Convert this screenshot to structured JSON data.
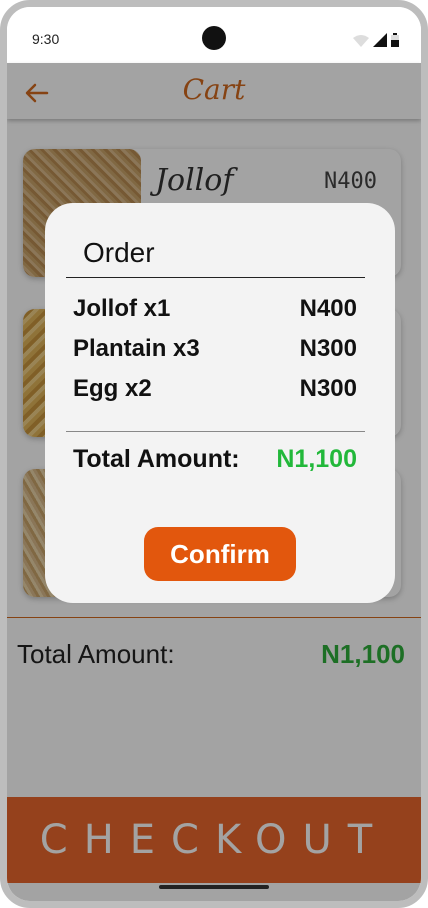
{
  "status_bar": {
    "time": "9:30"
  },
  "app_bar": {
    "title": "Cart"
  },
  "cart_items": [
    {
      "name": "Jollof",
      "price": "N400"
    }
  ],
  "summary": {
    "total_label": "Total Amount:",
    "total_value": "N1,100"
  },
  "checkout": {
    "label": "CHECKOUT"
  },
  "dialog": {
    "title": "Order",
    "items": [
      {
        "label": "Jollof x1",
        "price": "N400"
      },
      {
        "label": "Plantain x3",
        "price": "N300"
      },
      {
        "label": "Egg x2",
        "price": "N300"
      }
    ],
    "total_label": "Total Amount:",
    "total_value": "N1,100",
    "confirm_label": "Confirm"
  },
  "colors": {
    "accent": "#e9672d",
    "confirm": "#e2570d",
    "total_green": "#22b83a",
    "title_orange": "#d2691e"
  }
}
